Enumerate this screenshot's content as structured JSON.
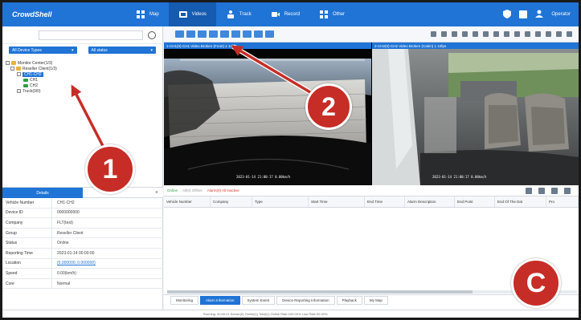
{
  "app": {
    "brand": "CrowdShell"
  },
  "nav": {
    "items": [
      {
        "label": "Map",
        "active": false
      },
      {
        "label": "Videos",
        "active": true
      },
      {
        "label": "Track",
        "active": false
      },
      {
        "label": "Record",
        "active": false
      },
      {
        "label": "Other",
        "active": false
      }
    ],
    "user": "Operator"
  },
  "search": {
    "placeholder": ""
  },
  "filters": {
    "left": "All Device Types",
    "right": "All status"
  },
  "tree": [
    {
      "label": "Monitor Center(1/3)",
      "level": 0,
      "toggle": "-"
    },
    {
      "label": "Reseller Client(1/3)",
      "level": 1,
      "toggle": "-"
    },
    {
      "label": "CH1-CH2",
      "level": 2,
      "toggle": "-",
      "selected": true
    },
    {
      "label": "CH1",
      "level": 3
    },
    {
      "label": "CH2",
      "level": 3
    },
    {
      "label": "Truck(0/0)",
      "level": 2,
      "toggle": "+"
    }
  ],
  "details_tab": "Details",
  "details": [
    {
      "key": "Vehicle Number",
      "value": "CH1-CH2",
      "link": false
    },
    {
      "key": "Device ID",
      "value": "0000000000",
      "link": false
    },
    {
      "key": "Company",
      "value": "FLT(test)",
      "link": false
    },
    {
      "key": "Group",
      "value": "Reseller Client",
      "link": false
    },
    {
      "key": "Status",
      "value": "Online",
      "link": false
    },
    {
      "key": "Reporting Time",
      "value": "2023-01-14 00:00:00",
      "link": false
    },
    {
      "key": "Location",
      "value": "(0.000000, 0.000000)",
      "link": true
    },
    {
      "key": "Speed",
      "value": "0.00(km/h)",
      "link": false
    },
    {
      "key": "Core",
      "value": "Normal",
      "link": false
    }
  ],
  "videos": [
    {
      "title": "1-CH1(0)-CH1 Video Broken (Front) 1 10fps",
      "stamp": "2023-01-14 21:00:17  0.00km/h"
    },
    {
      "title": "2-CH2(0)-CH2 Video Broken (Cabin) 1 10fps",
      "stamp": "2023-01-14 21:00:17  0.00km/h"
    }
  ],
  "status_filter": {
    "online": "Online",
    "all": "All(0) Offline",
    "alarm": "Alarm(0) All Inactive"
  },
  "alarm_columns": [
    "Vehicle Number",
    "Company",
    "Type",
    "Start Time",
    "End Time",
    "Alarm Description",
    "End Point",
    "End Of The Dat",
    "Pro"
  ],
  "bottom_tabs": [
    {
      "label": "Monitoring",
      "active": false
    },
    {
      "label": "Alarm Information",
      "active": true
    },
    {
      "label": "System Event",
      "active": false
    },
    {
      "label": "Device Reporting Information",
      "active": false
    },
    {
      "label": "Playback",
      "active": false
    },
    {
      "label": "My Map",
      "active": false
    }
  ],
  "footer": "Running: 00:00:21   Server(0)   Online(1)   Total(1)   Online Rate:100.00%   Lost Rate:00.00%",
  "callouts": [
    "1",
    "2",
    "C"
  ],
  "colors": {
    "primary": "#1f74d6",
    "badge": "#c62d26",
    "arrow": "#c62d26"
  }
}
